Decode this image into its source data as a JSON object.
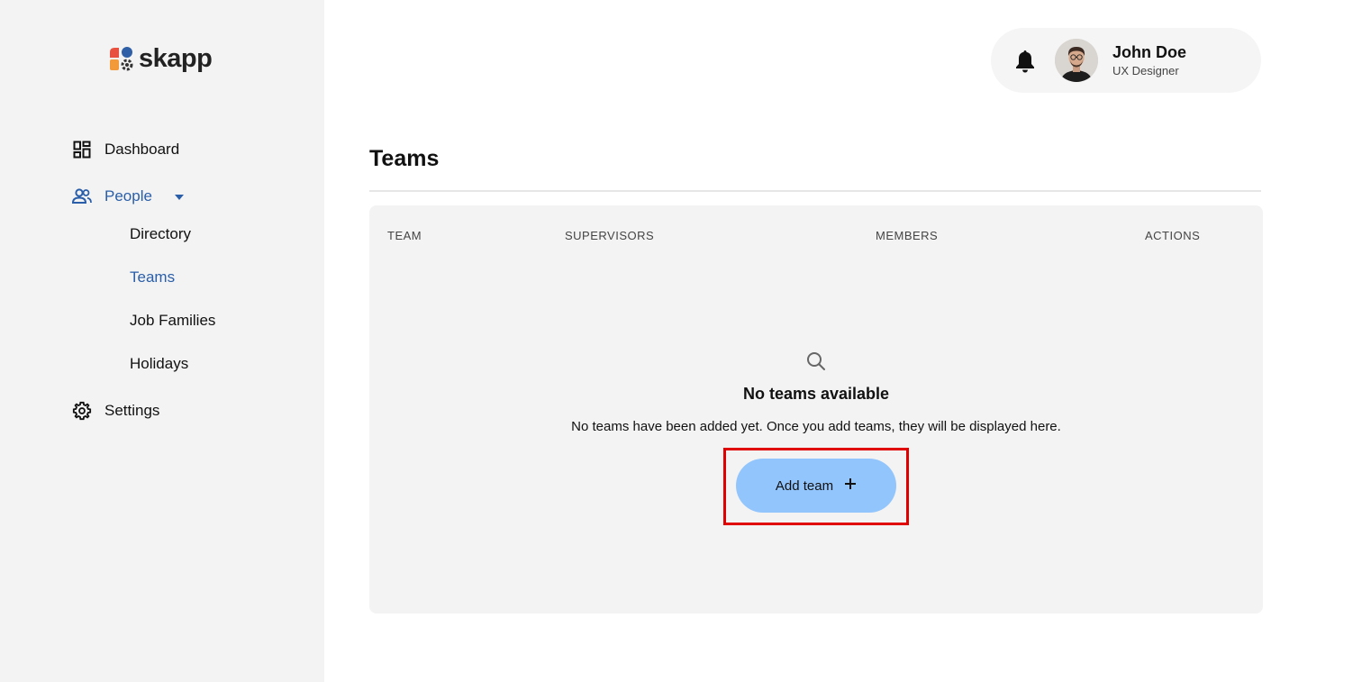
{
  "brand": {
    "name": "skapp"
  },
  "sidebar": {
    "items": [
      {
        "label": "Dashboard",
        "icon": "dashboard-icon"
      },
      {
        "label": "People",
        "icon": "people-icon",
        "expanded": true,
        "children": [
          {
            "label": "Directory"
          },
          {
            "label": "Teams",
            "active": true
          },
          {
            "label": "Job Families"
          },
          {
            "label": "Holidays"
          }
        ]
      },
      {
        "label": "Settings",
        "icon": "gear-icon"
      }
    ]
  },
  "header": {
    "user": {
      "name": "John Doe",
      "role": "UX Designer"
    }
  },
  "main": {
    "title": "Teams",
    "table": {
      "columns": [
        "TEAM",
        "SUPERVISORS",
        "MEMBERS",
        "ACTIONS"
      ]
    },
    "empty_state": {
      "title": "No teams available",
      "description": "No teams have been added yet. Once you add teams, they will be displayed here.",
      "button_label": "Add team"
    }
  },
  "colors": {
    "accent": "#2a5ea8",
    "button": "#93c5fd",
    "highlight": "#e00000",
    "sidebar_bg": "#f3f3f3"
  }
}
